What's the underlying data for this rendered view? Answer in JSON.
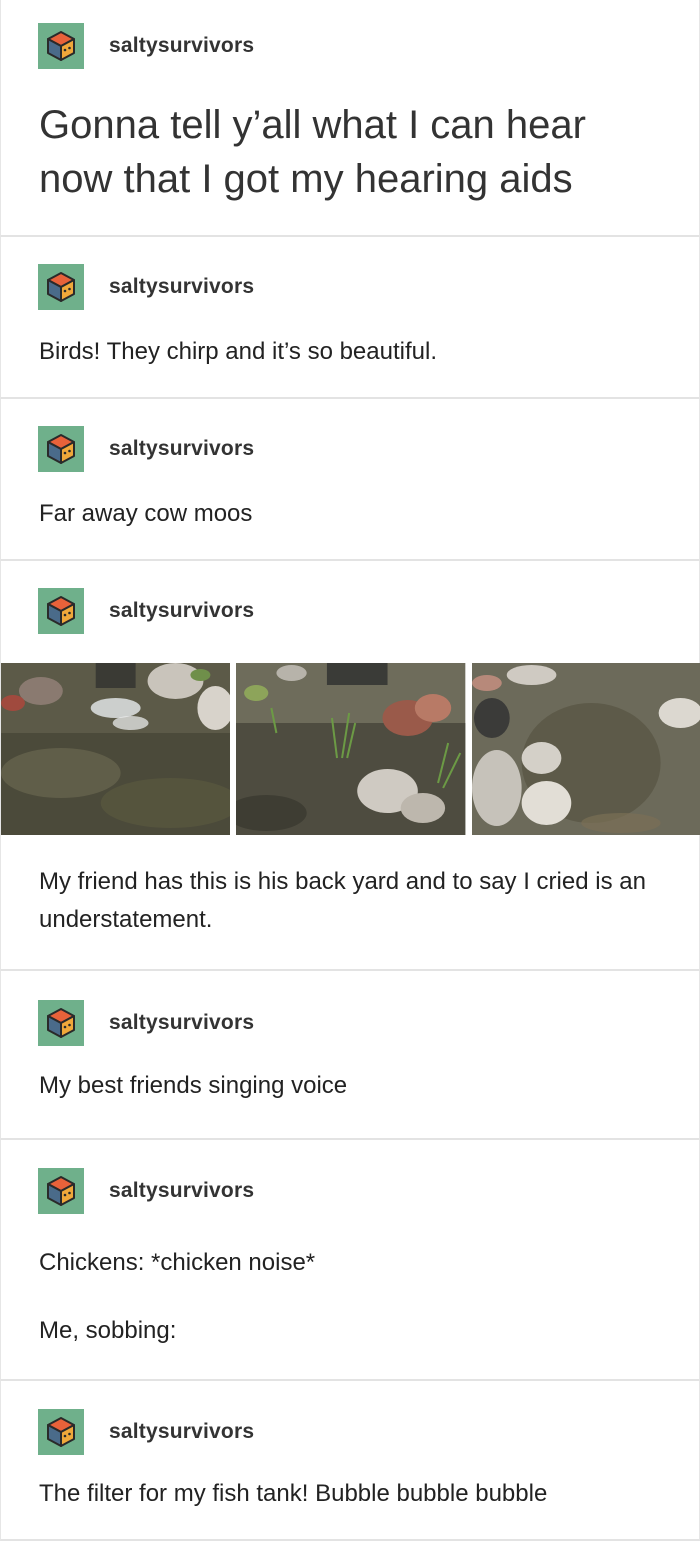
{
  "posts": [
    {
      "username": "saltysurvivors",
      "text": "Gonna tell y’all what I can hear now that I got my hearing aids"
    },
    {
      "username": "saltysurvivors",
      "text": "Birds! They chirp and it’s so beautiful."
    },
    {
      "username": "saltysurvivors",
      "text": "Far away cow moos"
    },
    {
      "username": "saltysurvivors",
      "text": "My friend has this is his back yard and to say I cried is an understatement."
    },
    {
      "username": "saltysurvivors",
      "text": "My best friends singing voice"
    },
    {
      "username": "saltysurvivors",
      "text": "Chickens: *chicken noise*",
      "text2": "Me, sobbing:"
    },
    {
      "username": "saltysurvivors",
      "text": "The filter for my fish tank! Bubble bubble bubble"
    }
  ],
  "avatar": {
    "icon": "cube-icon",
    "bg_color": "#6fb08b"
  }
}
